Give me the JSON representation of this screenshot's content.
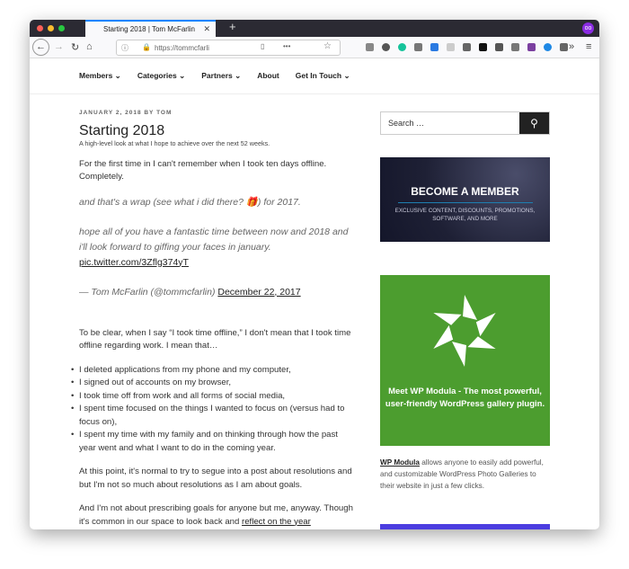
{
  "browser": {
    "tab_title": "Starting 2018 | Tom McFarlin",
    "url": "https://tommcfarli"
  },
  "nav": [
    "Members ⌄",
    "Categories ⌄",
    "Partners ⌄",
    "About",
    "Get In Touch ⌄"
  ],
  "post": {
    "meta": "JANUARY 2, 2018 BY TOM",
    "title": "Starting 2018",
    "subtitle": "A high-level look at what I hope to achieve over the next 52 weeks.",
    "intro": "For the first time in I can't remember when I took ten days offline. Completely.",
    "tweet": {
      "line1": "and that's a wrap (see what i did there? 🎁) for 2017.",
      "line2": "hope all of you have a fantastic time between now and 2018 and i'll look forward to giffing your faces in january.",
      "link": "pic.twitter.com/3Zflg374yT",
      "author": "— Tom McFarlin (@tommcfarlin)",
      "date": "December 22, 2017"
    },
    "para1": "To be clear, when I say “I took time offline,” I don't mean that I took time offline regarding work. I mean that…",
    "list": [
      "I deleted applications from my phone and my computer,",
      "I signed out of accounts on my browser,",
      "I took time off from work and all forms of social media,",
      "I spent time focused on the things I wanted to focus on (versus had to focus on),",
      "I spent my time with my family and on thinking through how the past year went and what I want to do in the coming year."
    ],
    "para2": "At this point, it's normal to try to segue into a post about resolutions and but I'm not so much about resolutions as I am about goals.",
    "para3": "And I'm not about prescribing goals for anyone but me, anyway. Though it's common in our space to look back and",
    "para3_link": "reflect on the year"
  },
  "sidebar": {
    "search_placeholder": "Search …",
    "member": {
      "title": "BECOME A MEMBER",
      "subtitle": "EXCLUSIVE CONTENT, DISCOUNTS, PROMOTIONS, SOFTWARE, AND MORE"
    },
    "modula": {
      "banner": "Meet WP Modula - The most powerful, user-friendly WordPress gallery plugin.",
      "link": "WP Modula",
      "desc": " allows anyone to easily add powerful, and customizable WordPress Photo Galleries to their website in just a few clicks.",
      "color": "#4c9d2f"
    }
  }
}
